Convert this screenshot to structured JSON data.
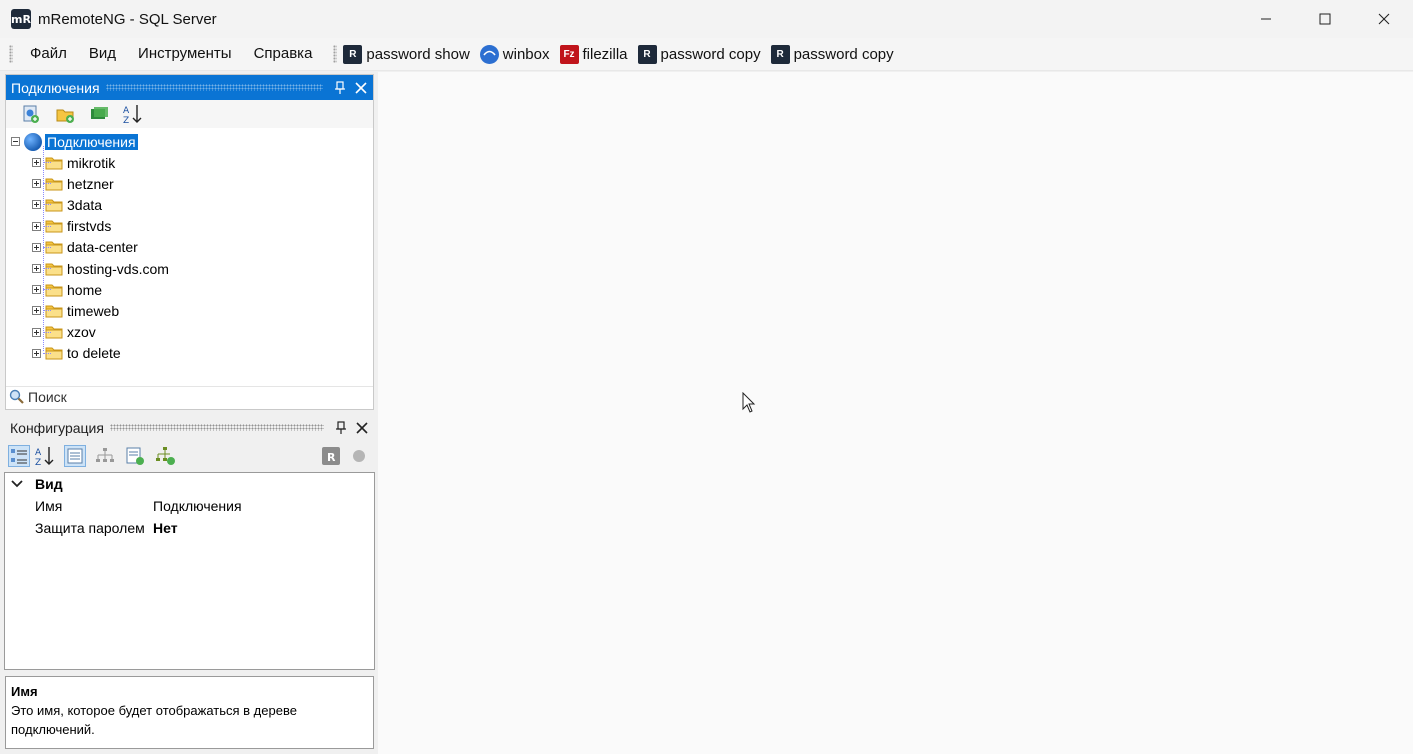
{
  "window": {
    "title": "mRemoteNG - SQL Server",
    "icon_text": "mR"
  },
  "menu": {
    "items": [
      "Файл",
      "Вид",
      "Инструменты",
      "Справка"
    ]
  },
  "external_tools": [
    {
      "label": "password show",
      "icon": "mremoteng-icon"
    },
    {
      "label": "winbox",
      "icon": "winbox-icon"
    },
    {
      "label": "filezilla",
      "icon": "filezilla-icon"
    },
    {
      "label": "password copy",
      "icon": "mremoteng-icon"
    },
    {
      "label": "password copy",
      "icon": "mremoteng-icon"
    }
  ],
  "connections_panel": {
    "title": "Подключения",
    "root": "Подключения",
    "folders": [
      "mikrotik",
      "hetzner",
      "3data",
      "firstvds",
      "data-center",
      "hosting-vds.com",
      "home",
      "timeweb",
      "xzov",
      "to delete"
    ],
    "search_placeholder": "Поиск"
  },
  "config_panel": {
    "title": "Конфигурация",
    "category": "Вид",
    "properties": [
      {
        "name": "Имя",
        "value": "Подключения",
        "bold": false
      },
      {
        "name": "Защита паролем",
        "value": "Нет",
        "bold": true
      }
    ]
  },
  "description": {
    "title": "Имя",
    "text": "Это имя, которое будет отображаться в дереве подключений."
  },
  "colors": {
    "accent": "#0a74d4",
    "folder": "#f5c542"
  }
}
